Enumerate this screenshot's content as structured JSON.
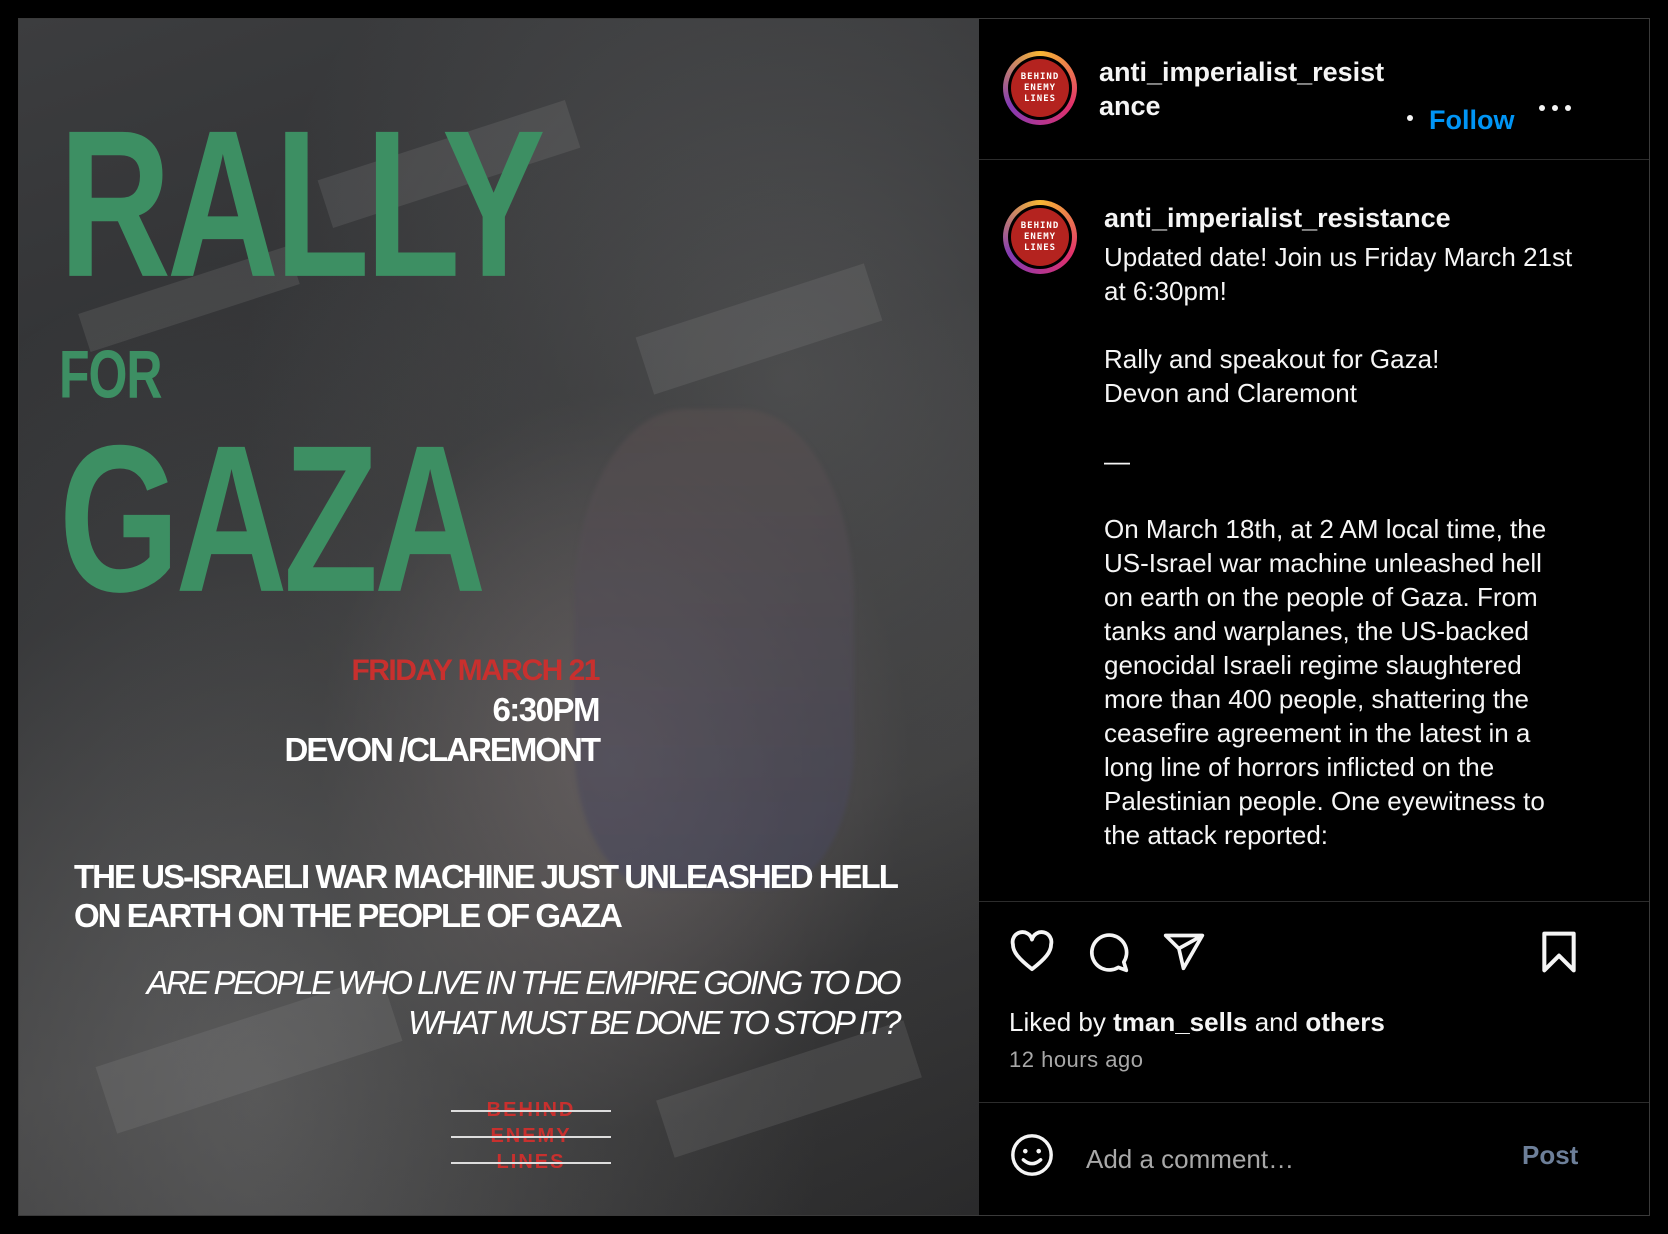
{
  "poster": {
    "title_line1": "RALLY",
    "title_line2": "FOR",
    "title_line3": "GAZA",
    "date": "FRIDAY MARCH 21",
    "time": "6:30PM",
    "location": "DEVON /CLAREMONT",
    "headline": "THE US-ISRAELI WAR MACHINE JUST UNLEASHED HELL ON EARTH ON THE PEOPLE OF GAZA",
    "question": "ARE PEOPLE WHO LIVE IN THE EMPIRE GOING TO DO WHAT MUST BE DONE TO STOP IT?",
    "logo_lines": [
      "BEHIND",
      "ENEMY",
      "LINES"
    ]
  },
  "header": {
    "username": "anti_imperialist_resistance",
    "follow_label": "Follow",
    "avatar_text": "BEHIND ENEMY LINES"
  },
  "caption": {
    "username": "anti_imperialist_resistance",
    "text": "Updated date! Join us Friday March 21st at 6:30pm!\n\nRally and speakout for Gaza!\nDevon and Claremont\n\n—\n\nOn March 18th, at 2 AM local time, the US-Israel war machine unleashed hell on earth on the people of Gaza. From tanks and warplanes, the US-backed genocidal Israeli regime slaughtered more than 400 people, shattering the ceasefire agreement in the latest in a long line of horrors inflicted on the Palestinian people. One eyewitness to the attack reported:"
  },
  "actions": {
    "liked_by_prefix": "Liked by",
    "liked_by_user": "tman_sells",
    "liked_by_and": "and",
    "liked_by_others": "others",
    "timestamp": "12 hours ago"
  },
  "comment": {
    "placeholder": "Add a comment…",
    "post_label": "Post"
  },
  "colors": {
    "accent": "#0095f6",
    "poster_green": "#3d8f63",
    "poster_red": "#c8302e"
  },
  "icons": [
    "heart-icon",
    "comment-icon",
    "share-icon",
    "bookmark-icon",
    "more-icon",
    "emoji-icon"
  ]
}
